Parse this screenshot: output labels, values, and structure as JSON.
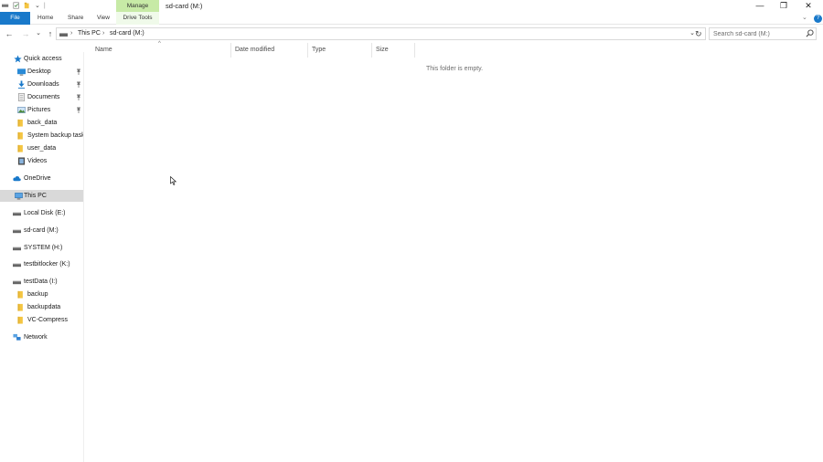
{
  "window": {
    "title": "sd-card (M:)",
    "manage_tab": "Manage"
  },
  "ribbon": {
    "tabs": [
      "File",
      "Home",
      "Share",
      "View"
    ],
    "drive_tools": "Drive Tools"
  },
  "address": {
    "segments": [
      "This PC",
      "sd-card (M:)"
    ],
    "search_placeholder": "Search sd-card (M:)"
  },
  "columns": [
    "Name",
    "Date modified",
    "Type",
    "Size"
  ],
  "empty_message": "This folder is empty.",
  "nav": {
    "quick_access": "Quick access",
    "quick_items": [
      {
        "label": "Desktop",
        "pinned": true,
        "icon": "desktop-icon"
      },
      {
        "label": "Downloads",
        "pinned": true,
        "icon": "downloads-icon"
      },
      {
        "label": "Documents",
        "pinned": true,
        "icon": "documents-icon"
      },
      {
        "label": "Pictures",
        "pinned": true,
        "icon": "pictures-icon"
      },
      {
        "label": "back_data",
        "pinned": false,
        "icon": "folder-icon"
      },
      {
        "label": "System backup task",
        "pinned": false,
        "icon": "folder-icon"
      },
      {
        "label": "user_data",
        "pinned": false,
        "icon": "folder-icon"
      },
      {
        "label": "Videos",
        "pinned": false,
        "icon": "videos-icon"
      }
    ],
    "onedrive": "OneDrive",
    "this_pc": "This PC",
    "drives": [
      "Local Disk (E:)",
      "sd-card (M:)",
      "SYSTEM (H:)",
      "testbitlocker (K:)",
      "testData (I:)"
    ],
    "testdata_children": [
      "backup",
      "backupdata",
      "VC-Compress"
    ],
    "network": "Network"
  },
  "colors": {
    "accent": "#1979ca",
    "manage": "#c7eaa6",
    "folder": "#f4c542",
    "selected": "#d9d9d9"
  }
}
